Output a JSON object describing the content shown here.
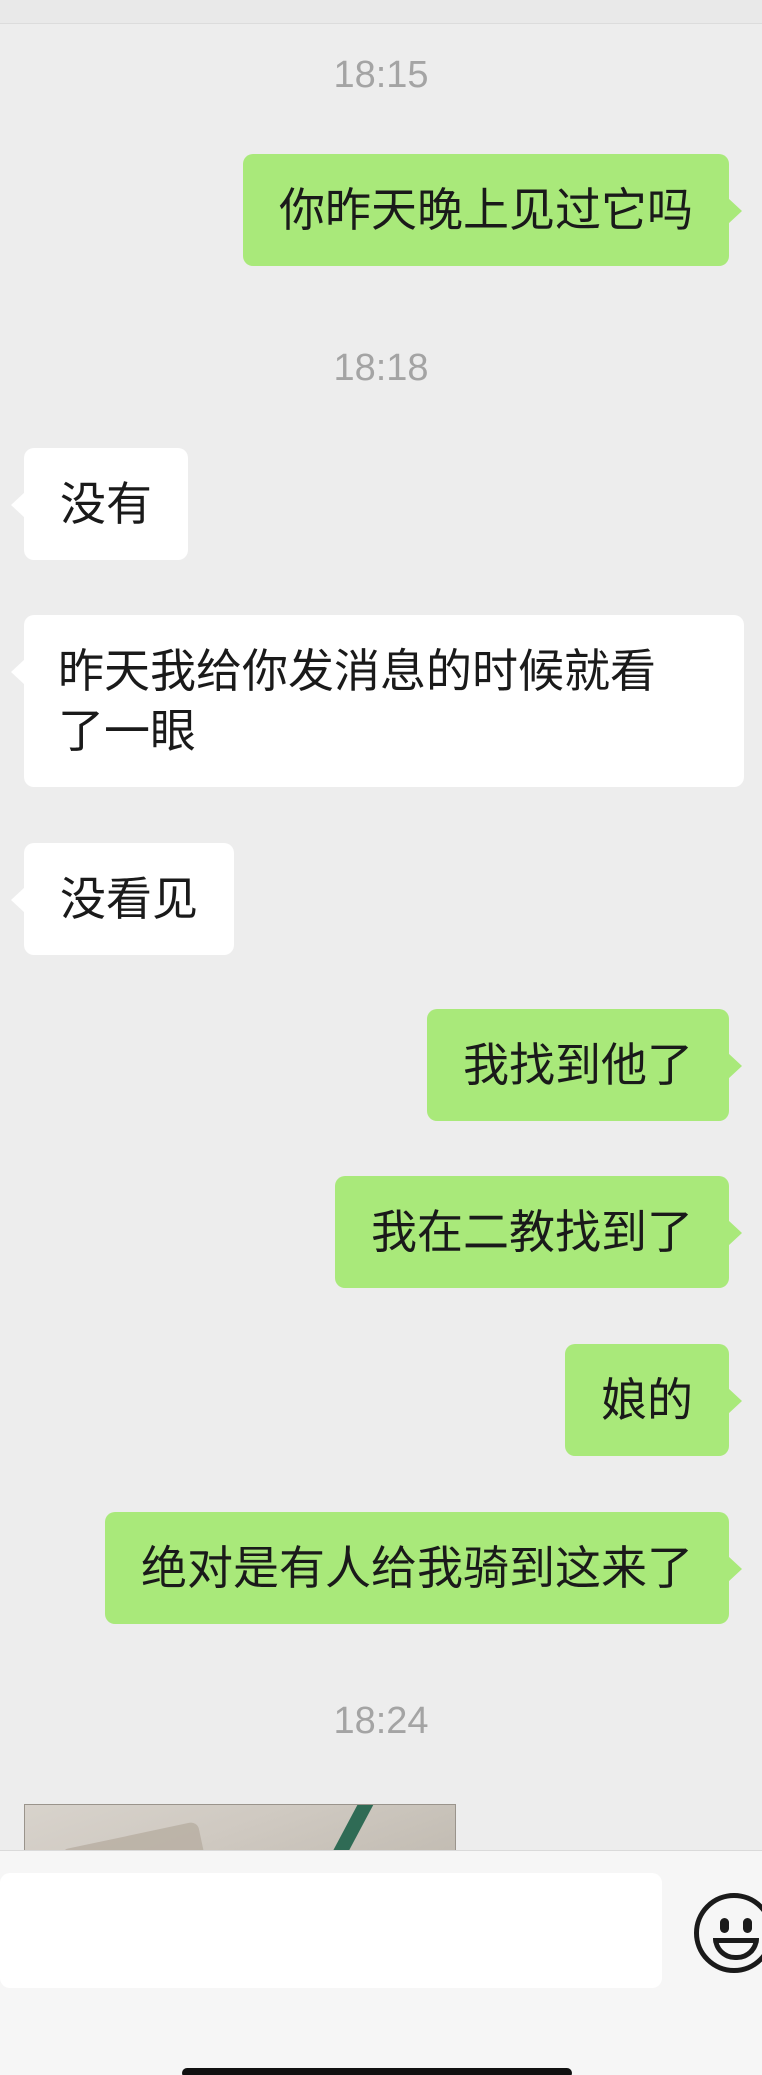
{
  "messages": [
    {
      "type": "time",
      "text": "18:15"
    },
    {
      "type": "out",
      "text": "你昨天晚上见过它吗"
    },
    {
      "type": "time",
      "text": "18:18"
    },
    {
      "type": "in",
      "text": "没有"
    },
    {
      "type": "in",
      "line1": "昨天我给你发消息的时候就看",
      "line2": "了一眼"
    },
    {
      "type": "in",
      "text": "没看见"
    },
    {
      "type": "out",
      "text": "我找到他了"
    },
    {
      "type": "out",
      "text": "我在二教找到了"
    },
    {
      "type": "out",
      "text": "娘的"
    },
    {
      "type": "out",
      "text": "绝对是有人给我骑到这来了"
    },
    {
      "type": "time",
      "text": "18:24"
    }
  ],
  "input": {
    "placeholder": ""
  },
  "icons": {
    "emoji": "emoji-face-icon"
  },
  "colors": {
    "outgoing_bubble": "#a9e97a",
    "incoming_bubble": "#ffffff",
    "background": "#ededed",
    "timestamp": "#a4a4a4"
  }
}
